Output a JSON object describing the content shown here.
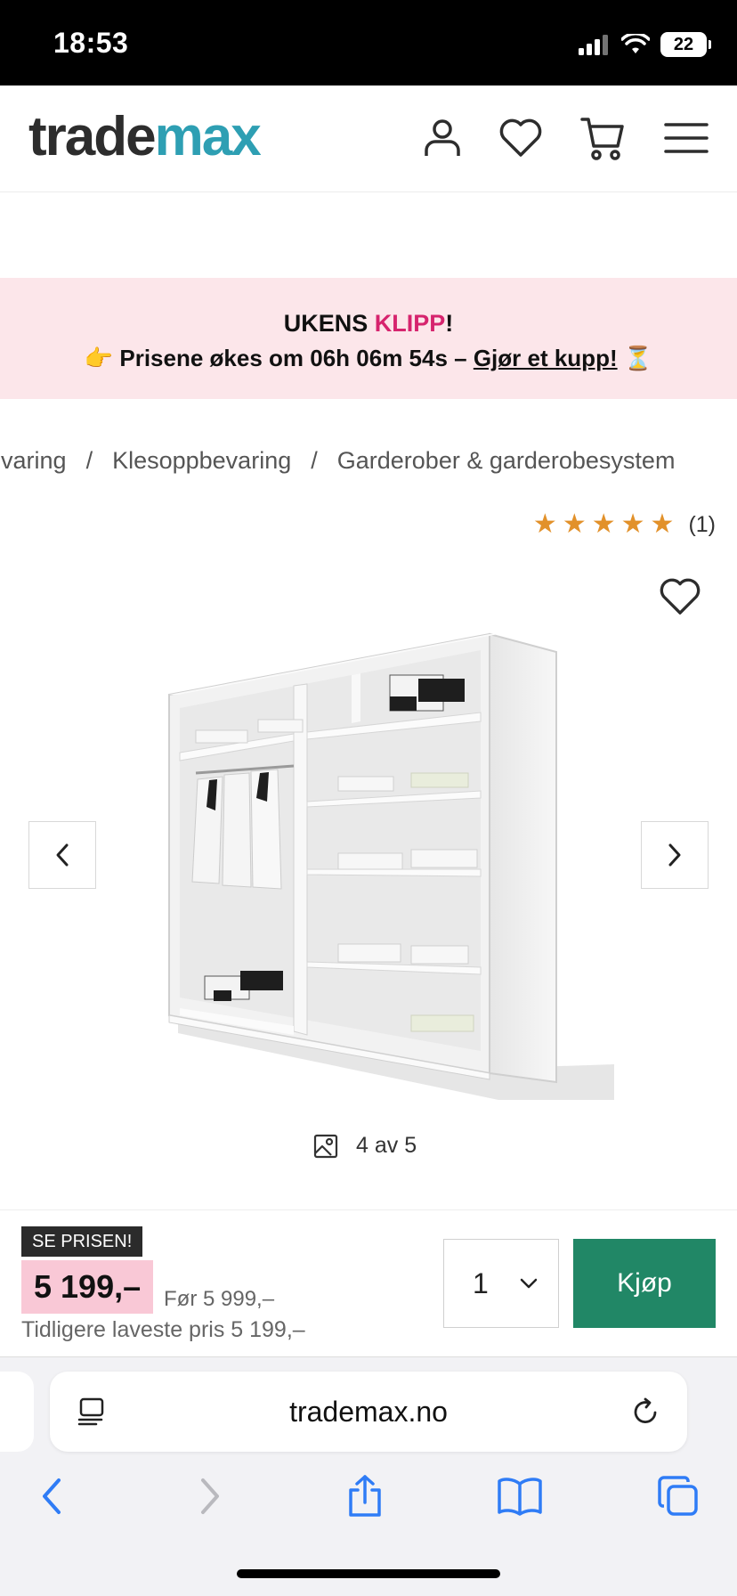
{
  "status_bar": {
    "time": "18:53",
    "battery": "22"
  },
  "header": {
    "logo_part1": "trade",
    "logo_part2": "max",
    "icons": [
      "account-icon",
      "heart-icon",
      "cart-icon",
      "menu-icon"
    ]
  },
  "promo": {
    "title_prefix": "UKENS ",
    "title_highlight": "KLIPP",
    "title_suffix": "!",
    "emoji_pointer": "👉",
    "line_text": "Prisene økes om 06h 06m 54s – ",
    "link_text": "Gjør et kupp!",
    "emoji_hourglass": "⏳"
  },
  "breadcrumb": {
    "items": [
      "evaring",
      "Klesoppbevaring",
      "Garderober & garderobesystem"
    ],
    "separator": "/"
  },
  "rating": {
    "stars": 5,
    "star_glyph": "★",
    "count": "(1)"
  },
  "gallery": {
    "counter": "4 av 5"
  },
  "purchase": {
    "badge": "SE PRISEN!",
    "price": "5 199,–",
    "old_price": "Før 5 999,–",
    "lowest_price": "Tidligere laveste pris 5 199,–",
    "quantity": "1",
    "buy_label": "Kjøp"
  },
  "browser": {
    "url": "trademax.no"
  },
  "colors": {
    "brand_dark": "#2d2d2d",
    "brand_teal": "#2e9fb3",
    "promo_bg": "#fce6ea",
    "promo_pink": "#d6246e",
    "star": "#e2912a",
    "price_bg": "#f9c8d6",
    "buy_green": "#218766",
    "safari_blue": "#2f7cf6"
  }
}
